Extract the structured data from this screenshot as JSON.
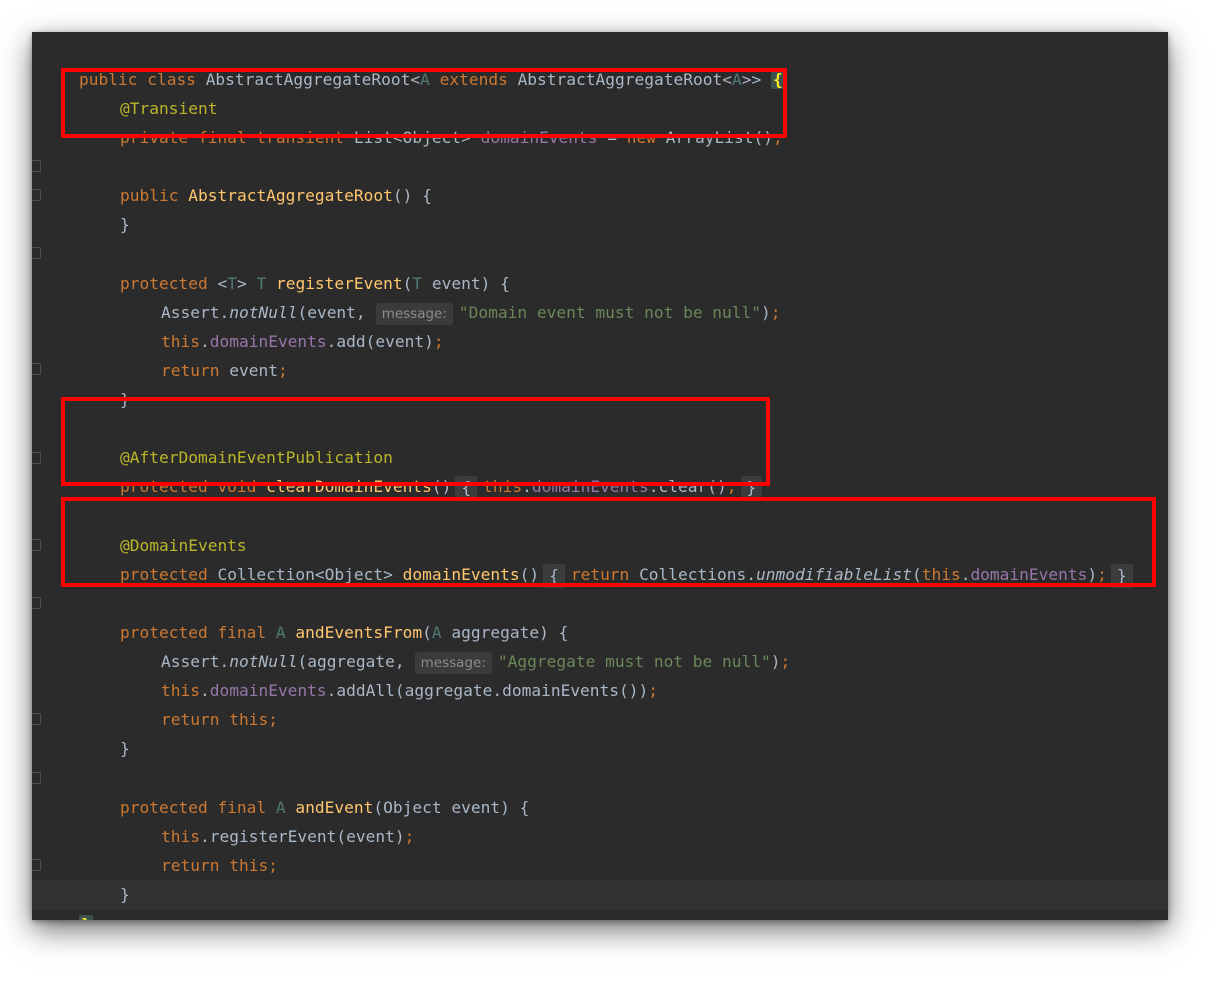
{
  "code": {
    "l1": {
      "kw": "public class ",
      "cls": "AbstractAggregateRoot<",
      "tp1": "A",
      "ext": " extends ",
      "cls2": "AbstractAggregateRoot<",
      "tp2": "A",
      "end": ">> ",
      "brace": "{"
    },
    "l2": {
      "ann": "@Transient"
    },
    "l3": {
      "kw": "private final transient ",
      "type": "List<Object> ",
      "fld": "domainEvents",
      "eq": " = ",
      "new": "new ",
      "rest": "ArrayList()",
      "semi": ";"
    },
    "l5": {
      "kw": "public ",
      "fn": "AbstractAggregateRoot",
      "rest": "() {"
    },
    "l6": {
      "brace": "}"
    },
    "l8": {
      "kw": "protected ",
      "lt": "<",
      "tp": "T",
      "gt": "> ",
      "tp2": "T",
      "sp": " ",
      "fn": "registerEvent",
      "lp": "(",
      "tp3": "T",
      "rest": " event) {"
    },
    "l9": {
      "pre": "Assert.",
      "method": "notNull",
      "args": "(event,",
      "hint": "message:",
      "str": "\"Domain event must not be null\"",
      "end": ")",
      "semi": ";"
    },
    "l10": {
      "kw": "this",
      "dot": ".",
      "fld": "domainEvents",
      "rest": ".add(event)",
      "semi": ";"
    },
    "l11": {
      "kw": "return ",
      "rest": "event",
      "semi": ";"
    },
    "l12": {
      "brace": "}"
    },
    "l14": {
      "ann": "@AfterDomainEventPublication"
    },
    "l15": {
      "kw": "protected void ",
      "fn": "clearDomainEvents",
      "rest": "()",
      "ob": "{",
      "this": "this",
      "dot": ".",
      "fld": "domainEvents",
      "call": ".clear()",
      "semi": ";",
      "cb": "}"
    },
    "l17": {
      "ann": "@DomainEvents"
    },
    "l18": {
      "kw": "protected ",
      "type": "Collection<Object> ",
      "fn": "domainEvents",
      "rest": "()",
      "ob": "{",
      "ret": "return ",
      "cls": "Collections.",
      "method": "unmodifiableList",
      "lp": "(",
      "this": "this",
      "dot": ".",
      "fld": "domainEvents",
      "rp": ")",
      "semi": ";",
      "cb": "}"
    },
    "l20": {
      "kw": "protected final ",
      "tp": "A",
      "sp": " ",
      "fn": "andEventsFrom",
      "lp": "(",
      "tp2": "A",
      "rest": " aggregate) {"
    },
    "l21": {
      "pre": "Assert.",
      "method": "notNull",
      "args": "(aggregate,",
      "hint": "message:",
      "str": "\"Aggregate must not be null\"",
      "end": ")",
      "semi": ";"
    },
    "l22": {
      "kw": "this",
      "dot": ".",
      "fld": "domainEvents",
      "rest": ".addAll(aggregate.domainEvents())",
      "semi": ";"
    },
    "l23": {
      "kw": "return this",
      "semi": ";"
    },
    "l24": {
      "brace": "}"
    },
    "l26": {
      "kw": "protected final ",
      "tp": "A",
      "sp": " ",
      "fn": "andEvent",
      "rest": "(Object event) {"
    },
    "l27": {
      "kw": "this",
      "rest": ".registerEvent(event)",
      "semi": ";"
    },
    "l28": {
      "kw": "return this",
      "semi": ";"
    },
    "l29": {
      "brace": "}"
    },
    "l30": {
      "brace": "}"
    }
  },
  "colors": {
    "background": "#2b2b2b",
    "keyword": "#cc7832",
    "annotation": "#bbb529",
    "method": "#ffc66d",
    "field": "#9876aa",
    "string": "#6a8759",
    "type_param": "#507874",
    "highlight_box": "#ff0000"
  }
}
